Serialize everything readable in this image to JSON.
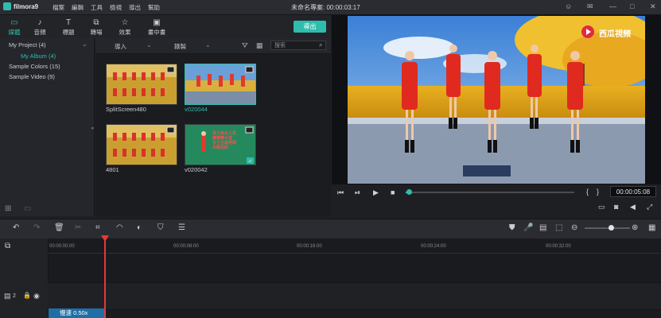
{
  "app": {
    "name": "filmora9",
    "menu": [
      "檔案",
      "編輯",
      "工具",
      "檢視",
      "導出",
      "幫助"
    ],
    "project_title": "未命名專案: 00:00:03:17",
    "window_controls": [
      "☺",
      "✉",
      "—",
      "□",
      "✕"
    ]
  },
  "tabs": [
    {
      "label": "媒體",
      "icon": "folder-icon"
    },
    {
      "label": "音頻",
      "icon": "music-icon"
    },
    {
      "label": "標題",
      "icon": "title-icon"
    },
    {
      "label": "轉場",
      "icon": "transition-icon"
    },
    {
      "label": "效果",
      "icon": "effects-icon"
    },
    {
      "label": "畫中畫",
      "icon": "pip-icon"
    }
  ],
  "export_label": "導出",
  "tree": {
    "items": [
      {
        "label": "My Project (4)",
        "active": false
      },
      {
        "label": "My Album (4)",
        "active": true
      },
      {
        "label": "Sample Colors (15)",
        "active": false
      },
      {
        "label": "Sample Video (9)",
        "active": false
      }
    ]
  },
  "media_bar": {
    "import_label": "導入",
    "record_label": "錄製",
    "search_placeholder": "搜索"
  },
  "media_items": [
    {
      "name": "SplitScreen480",
      "selected": false
    },
    {
      "name": "v020044",
      "selected": true
    },
    {
      "name": "4801",
      "selected": false
    },
    {
      "name": "v020042",
      "selected": false
    }
  ],
  "thumb_overlay_text": "百人郎女人花\n廣場舞大型\n五十五歲老師\n大阪拍的",
  "watermark": "西瓜視頻",
  "preview": {
    "timecode": "00:00:05:08",
    "progress": 0.02
  },
  "timeline": {
    "ruler": [
      "00:00:00:00",
      "00:00:08:00",
      "00:00:16:00",
      "00:00:24:00",
      "00:00:32:00"
    ],
    "track_label": "2",
    "clip_label": "慢速 0.50x"
  },
  "colors": {
    "accent": "#2fbcad",
    "playhead": "#e53935",
    "clip": "#1f6fa6"
  }
}
